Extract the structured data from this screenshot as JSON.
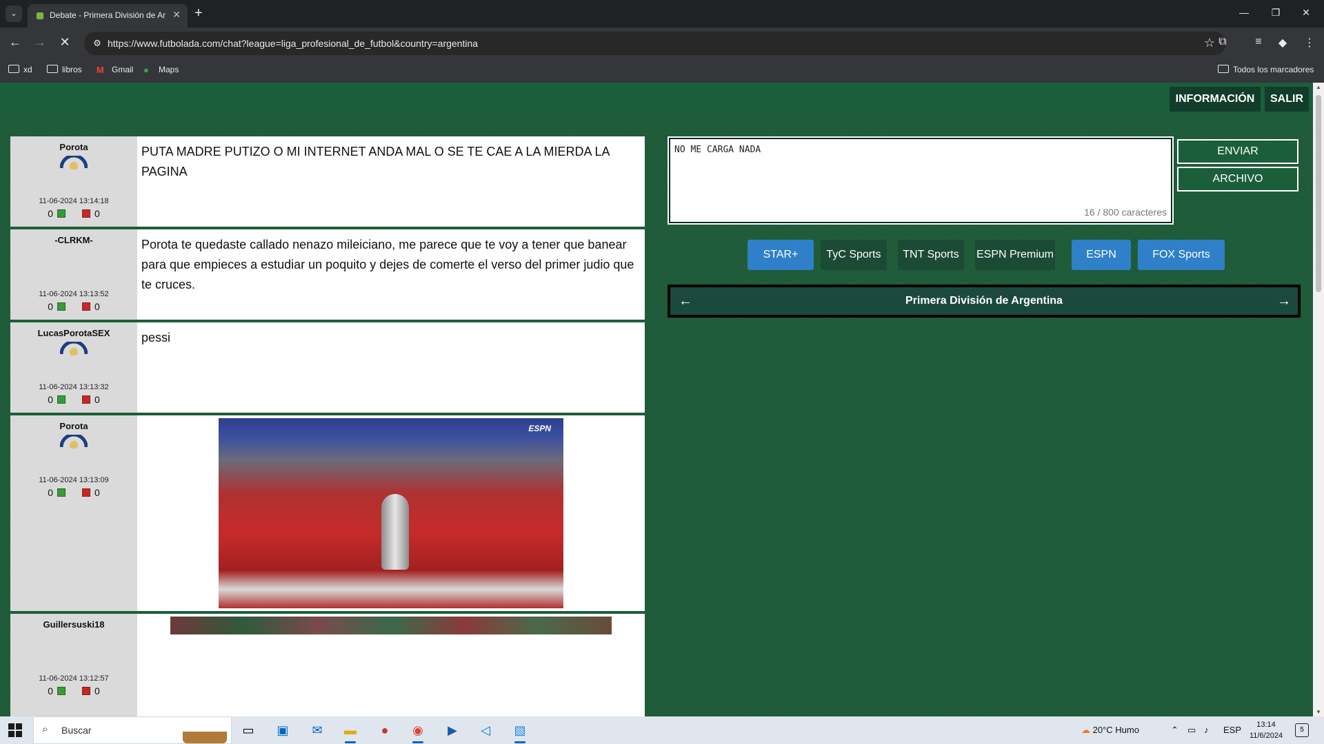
{
  "browser": {
    "tab_title": "Debate - Primera División de Ar",
    "url": "https://www.futbolada.com/chat?league=liga_profesional_de_futbol&country=argentina",
    "bookmarks": [
      "xd",
      "libros",
      "Gmail",
      "Maps"
    ],
    "all_bookmarks": "Todos los marcadores"
  },
  "header": {
    "info_label": "INFORMACIÓN",
    "exit_label": "SALIR"
  },
  "messages": [
    {
      "user": "Porota",
      "date": "11-06-2024 13:14:18",
      "up": "0",
      "down": "0",
      "text": "PUTA MADRE PUTIZO O MI INTERNET ANDA MAL O SE TE CAE A LA MIERDA LA PAGINA"
    },
    {
      "user": "-CLRKM-",
      "date": "11-06-2024 13:13:52",
      "up": "0",
      "down": "0",
      "text": "Porota te quedaste callado nenazo mileiciano, me parece que te voy a tener que banear para que empieces a estudiar un poquito y dejes de comerte el verso del primer judio que te cruces."
    },
    {
      "user": "LucasPorotaSEX",
      "date": "11-06-2024 13:13:32",
      "up": "0",
      "down": "0",
      "text": "pessi"
    },
    {
      "user": "Porota",
      "date": "11-06-2024 13:13:09",
      "up": "0",
      "down": "0",
      "image_watermark": "ESPN"
    },
    {
      "user": "Guillersuski18",
      "date": "11-06-2024 13:12:57",
      "up": "0",
      "down": "0"
    }
  ],
  "composer": {
    "value": "NO ME CARGA NADA",
    "counter": "16 / 800 caracteres",
    "send_label": "ENVIAR",
    "file_label": "ARCHIVO"
  },
  "channels": [
    "STAR+",
    "TyC Sports",
    "TNT Sports",
    "ESPN Premium",
    "ESPN",
    "FOX Sports"
  ],
  "league": {
    "name": "Primera División de Argentina"
  },
  "taskbar": {
    "search_placeholder": "Buscar",
    "weather": "20°C  Humo",
    "lang": "ESP",
    "time": "13:14",
    "date": "11/6/2024",
    "notifications": "5"
  },
  "colors": {
    "page_bg": "#1e5a37",
    "chip_blue": "#2f80c8",
    "chip_dark": "#1b4a35"
  }
}
